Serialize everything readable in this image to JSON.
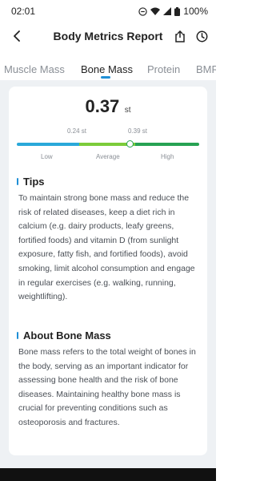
{
  "status_bar": {
    "time": "02:01",
    "battery": "100%"
  },
  "header": {
    "title": "Body Metrics Report"
  },
  "tabs": [
    {
      "label": "Muscle Mass"
    },
    {
      "label": "Bone Mass"
    },
    {
      "label": "Protein"
    },
    {
      "label": "BMR"
    }
  ],
  "metric": {
    "value": "0.37",
    "unit": "st",
    "threshold_low": "0.24 st",
    "threshold_high": "0.39 st",
    "ranges": [
      "Low",
      "Average",
      "High"
    ]
  },
  "tips": {
    "title": "Tips",
    "text": "To maintain strong bone mass and reduce the risk of related diseases, keep a diet rich in calcium (e.g. dairy products, leafy greens, fortified foods) and vitamin D (from sunlight exposure, fatty fish, and fortified foods), avoid smoking, limit alcohol consumption and engage in regular exercises (e.g. walking, running, weightlifting)."
  },
  "about": {
    "title": "About Bone Mass",
    "text": "Bone mass refers to the total weight of bones in the body, serving as an important indicator for assessing bone health and the risk of bone diseases. Maintaining healthy bone mass is crucial for preventing conditions such as osteoporosis and fractures."
  }
}
